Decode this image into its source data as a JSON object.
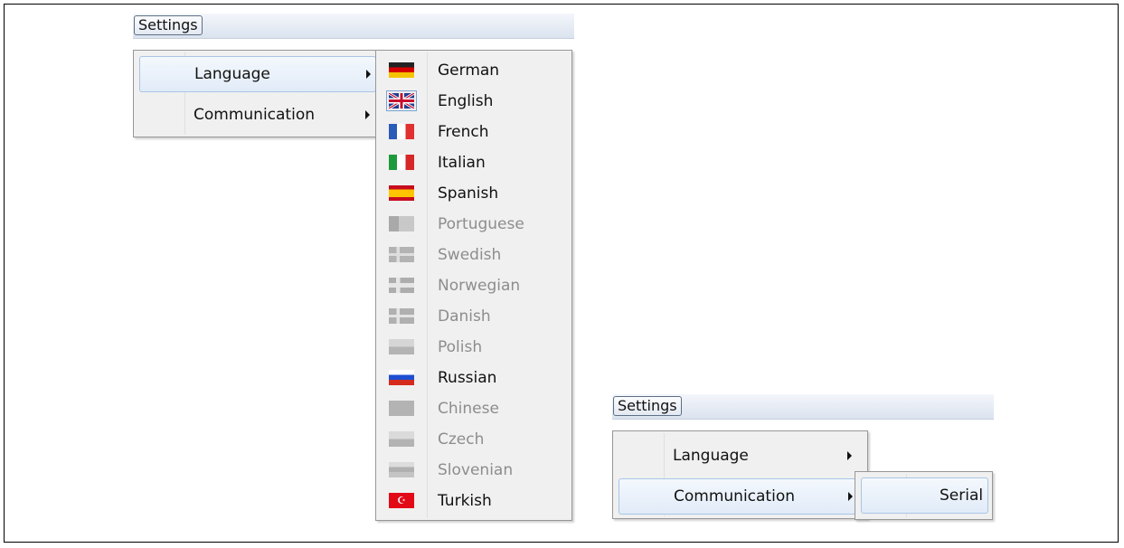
{
  "menubar": {
    "settings_label": "Settings"
  },
  "settings_menu": {
    "language_label": "Language",
    "communication_label": "Communication"
  },
  "language_menu": {
    "items": [
      {
        "id": "german",
        "label": "German",
        "enabled": true
      },
      {
        "id": "english",
        "label": "English",
        "enabled": true,
        "selected": true
      },
      {
        "id": "french",
        "label": "French",
        "enabled": true
      },
      {
        "id": "italian",
        "label": "Italian",
        "enabled": true
      },
      {
        "id": "spanish",
        "label": "Spanish",
        "enabled": true
      },
      {
        "id": "portuguese",
        "label": "Portuguese",
        "enabled": false
      },
      {
        "id": "swedish",
        "label": "Swedish",
        "enabled": false
      },
      {
        "id": "norwegian",
        "label": "Norwegian",
        "enabled": false
      },
      {
        "id": "danish",
        "label": "Danish",
        "enabled": false
      },
      {
        "id": "polish",
        "label": "Polish",
        "enabled": false
      },
      {
        "id": "russian",
        "label": "Russian",
        "enabled": true
      },
      {
        "id": "chinese",
        "label": "Chinese",
        "enabled": false
      },
      {
        "id": "czech",
        "label": "Czech",
        "enabled": false
      },
      {
        "id": "slovenian",
        "label": "Slovenian",
        "enabled": false
      },
      {
        "id": "turkish",
        "label": "Turkish",
        "enabled": true
      }
    ]
  },
  "communication_menu": {
    "serial_label": "Serial"
  },
  "colors": {
    "disabled_text": "#8d8d8d",
    "highlight_border": "#a9c5e6",
    "menu_bg": "#f0f0f0"
  }
}
